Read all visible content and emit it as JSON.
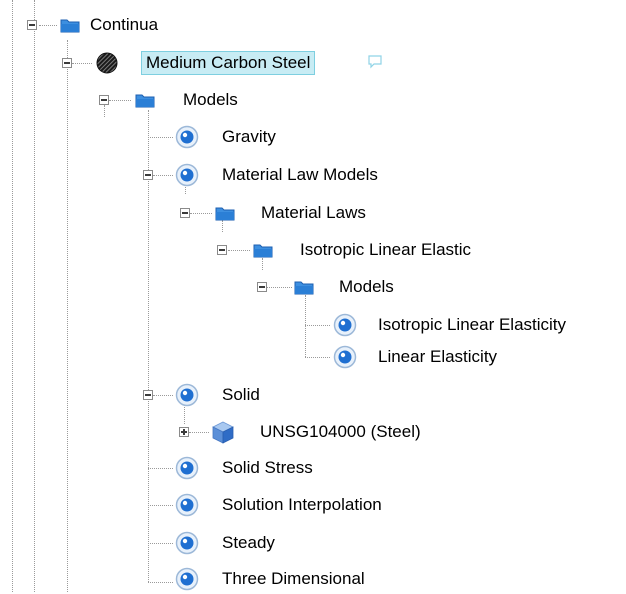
{
  "tree": {
    "continua": "Continua",
    "material": "Medium Carbon Steel",
    "models": "Models",
    "gravity": "Gravity",
    "material_law_models": "Material Law Models",
    "material_laws": "Material Laws",
    "isotropic_linear_elastic": "Isotropic Linear Elastic",
    "sub_models": "Models",
    "isotropic_linear_elasticity": "Isotropic Linear Elasticity",
    "linear_elasticity": "Linear Elasticity",
    "solid": "Solid",
    "steel_grade": "UNSG104000 (Steel)",
    "solid_stress": "Solid Stress",
    "solution_interpolation": "Solution Interpolation",
    "steady": "Steady",
    "three_dimensional": "Three Dimensional"
  },
  "icons": {
    "folder": "folder-icon",
    "model": "model-node-icon",
    "material": "material-sphere-icon",
    "comment": "comment-icon",
    "material_cube": "material-cube-icon",
    "expand": "expand-icon",
    "collapse": "collapse-icon"
  },
  "colors": {
    "selection_bg": "#c8ecf4",
    "folder_blue": "#2b7fd6",
    "model_blue": "#1f6fd1"
  }
}
